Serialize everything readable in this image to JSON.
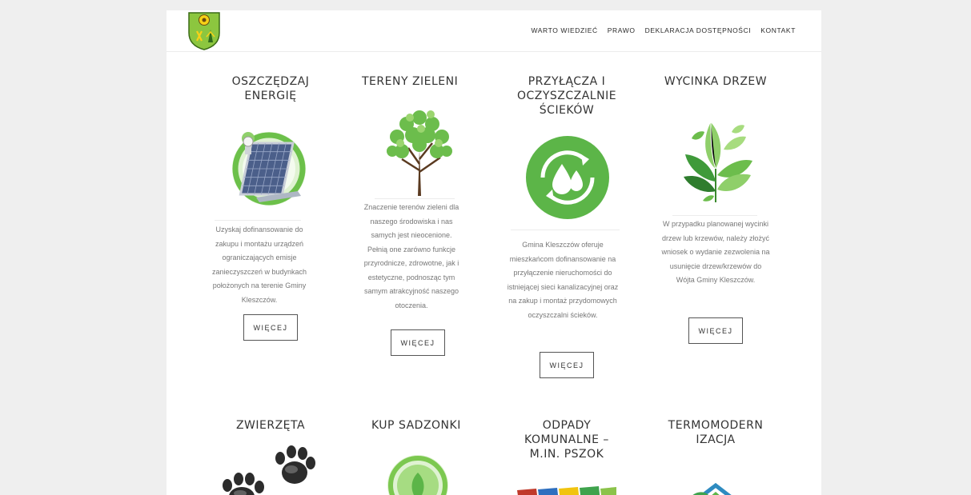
{
  "nav": {
    "items": [
      {
        "label": "WARTO WIEDZIEĆ"
      },
      {
        "label": "PRAWO"
      },
      {
        "label": "DEKLARACJA DOSTĘPNOŚCI"
      },
      {
        "label": "KONTAKT"
      }
    ]
  },
  "cards": [
    {
      "title": "OSZCZĘDZAJ ENERGIĘ",
      "text": "Uzyskaj dofinansowanie do zakupu i montażu urządzeń ograniczających emisje zanieczyszczeń w budynkach położonych na terenie Gminy Kleszczów.",
      "button": "WIĘCEJ"
    },
    {
      "title": "TERENY ZIELENI",
      "text": "Znaczenie terenów zieleni dla naszego środowiska i nas samych jest nieocenione. Pełnią one zarówno funkcje przyrodnicze, zdrowotne, jak i estetyczne, podnosząc tym samym atrakcyjność naszego otoczenia.",
      "button": "WIĘCEJ"
    },
    {
      "title": "PRZYŁĄCZA I OCZYSZCZALNIE ŚCIEKÓW",
      "text": "Gmina Kleszczów oferuje mieszkańcom dofinansowanie na przyłączenie nieruchomości do istniejącej sieci kanalizacyjnej oraz na zakup i montaż przydomowych oczyszczalni ścieków.",
      "button": "WIĘCEJ"
    },
    {
      "title": "WYCINKA DRZEW",
      "text": "W przypadku planowanej wycinki drzew lub krzewów, należy złożyć wniosek o wydanie zezwolenia na usunięcie drzew/krzewów do Wójta Gminy Kleszczów.",
      "button": "WIĘCEJ"
    }
  ],
  "cards_row2": [
    {
      "title": "ZWIERZĘTA"
    },
    {
      "title": "KUP SADZONKI"
    },
    {
      "title": "ODPADY KOMUNALNE – M.IN. PSZOK"
    },
    {
      "title": "TERMOMODERN IZACJA"
    }
  ],
  "colors": {
    "page_bg": "#efefef",
    "content_bg": "#ffffff",
    "green": "#5cb548",
    "dark_green": "#3a8a2d",
    "text": "#333333",
    "muted_text": "#777777"
  }
}
